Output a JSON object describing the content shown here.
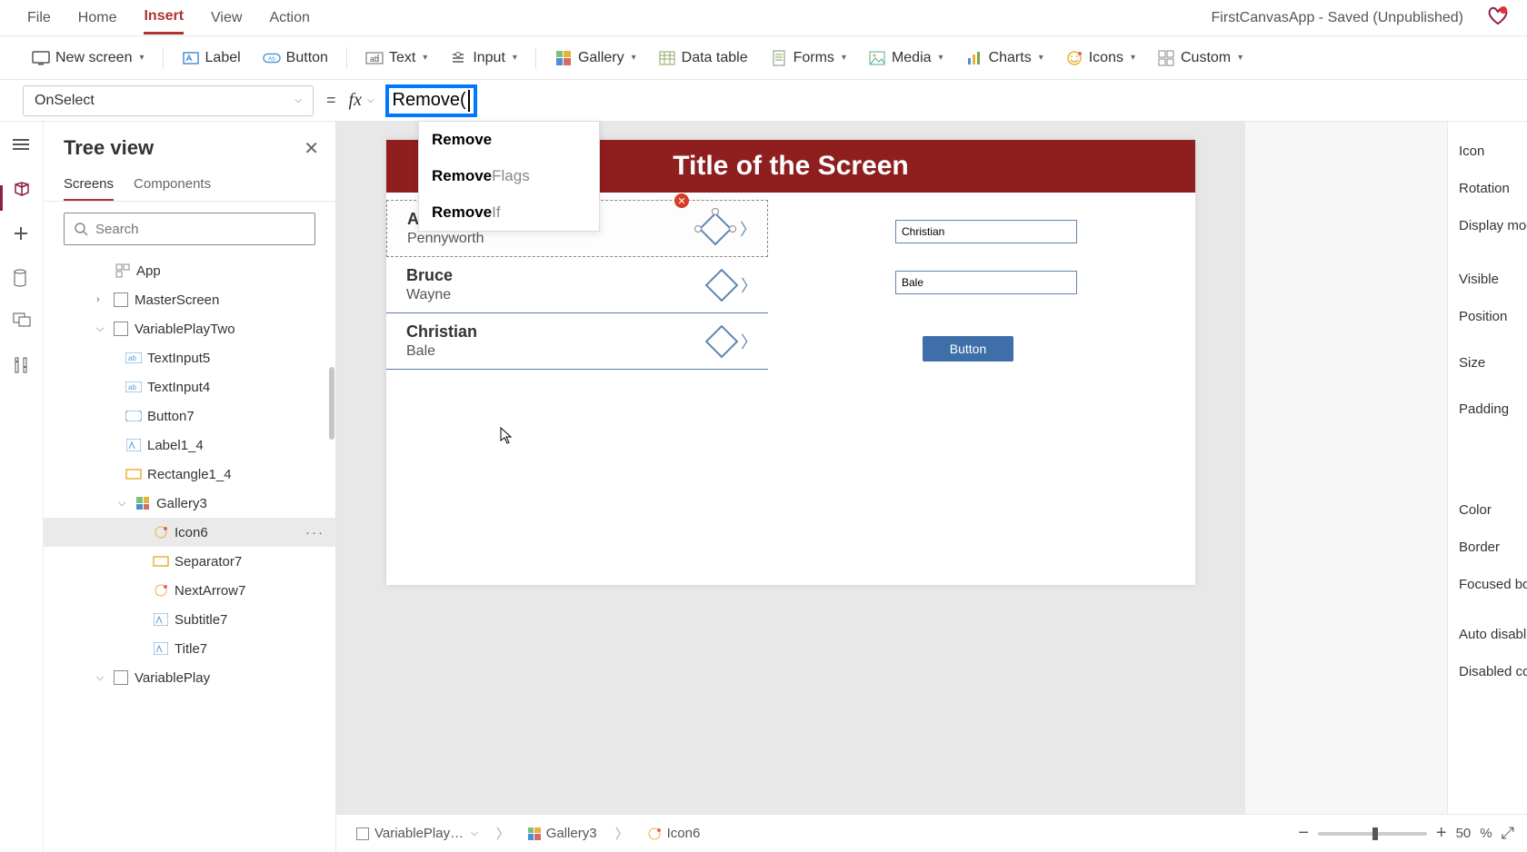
{
  "app_title": "FirstCanvasApp - Saved (Unpublished)",
  "top_menu": {
    "file": "File",
    "home": "Home",
    "insert": "Insert",
    "view": "View",
    "action": "Action"
  },
  "ribbon": {
    "new_screen": "New screen",
    "label": "Label",
    "button": "Button",
    "text": "Text",
    "input": "Input",
    "gallery": "Gallery",
    "data_table": "Data table",
    "forms": "Forms",
    "media": "Media",
    "charts": "Charts",
    "icons": "Icons",
    "custom": "Custom"
  },
  "formula": {
    "property": "OnSelect",
    "expression": "Remove(",
    "autocomplete": [
      {
        "match": "Remove",
        "rest": ""
      },
      {
        "match": "Remove",
        "rest": "Flags"
      },
      {
        "match": "Remove",
        "rest": "If"
      }
    ]
  },
  "tree": {
    "title": "Tree view",
    "tabs": {
      "screens": "Screens",
      "components": "Components"
    },
    "search_placeholder": "Search",
    "items": {
      "app": "App",
      "master": "MasterScreen",
      "varplay2": "VariablePlayTwo",
      "textinput5": "TextInput5",
      "textinput4": "TextInput4",
      "button7": "Button7",
      "label1_4": "Label1_4",
      "rect1_4": "Rectangle1_4",
      "gallery3": "Gallery3",
      "icon6": "Icon6",
      "sep7": "Separator7",
      "next7": "NextArrow7",
      "subtitle7": "Subtitle7",
      "title7": "Title7",
      "varplay": "VariablePlay"
    }
  },
  "canvas": {
    "screen_title": "Title of the Screen",
    "gallery": [
      {
        "first": "Alfred",
        "last": "Pennyworth"
      },
      {
        "first": "Bruce",
        "last": "Wayne"
      },
      {
        "first": "Christian",
        "last": "Bale"
      }
    ],
    "input1": "Christian",
    "input2": "Bale",
    "button": "Button"
  },
  "props": {
    "icon": "Icon",
    "rotation": "Rotation",
    "display_mode": "Display mode",
    "visible": "Visible",
    "position": "Position",
    "size": "Size",
    "padding": "Padding",
    "color": "Color",
    "border": "Border",
    "focused_border": "Focused border",
    "auto_disable": "Auto disable",
    "disabled_col": "Disabled color"
  },
  "status": {
    "crumb1": "VariablePlay…",
    "crumb2": "Gallery3",
    "crumb3": "Icon6",
    "zoom_value": "50",
    "zoom_pct": "%"
  }
}
